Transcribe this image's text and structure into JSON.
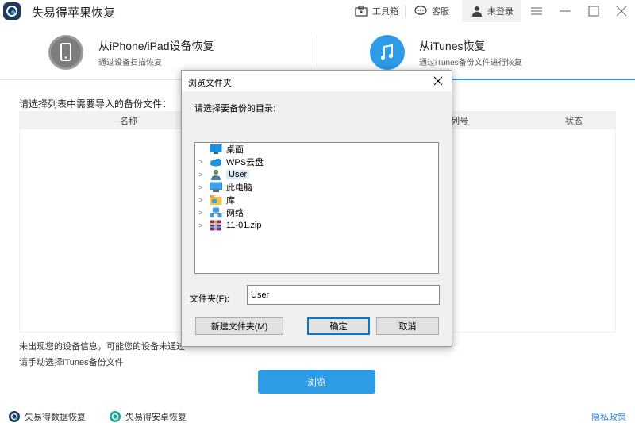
{
  "app": {
    "title": "失易得苹果恢复"
  },
  "titlebar": {
    "toolbox_label": "工具箱",
    "support_label": "客服",
    "login_label": "未登录"
  },
  "modes": [
    {
      "title": "从iPhone/iPad设备恢复",
      "subtitle": "通过设备扫描恢复"
    },
    {
      "title": "从iTunes恢复",
      "subtitle": "通过iTunes备份文件进行恢复"
    }
  ],
  "content": {
    "prompt": "请选择列表中需要导入的备份文件：",
    "columns": [
      "名称",
      "列号",
      "状态"
    ],
    "notice1": "未出现您的设备信息，可能您的设备未通过",
    "notice2": "请手动选择iTunes备份文件",
    "browse_label": "浏览"
  },
  "footer": {
    "link1": "失易得数据恢复",
    "link2": "失易得安卓恢复",
    "privacy": "隐私政策"
  },
  "dialog": {
    "title": "浏览文件夹",
    "prompt": "请选择要备份的目录:",
    "tree": [
      {
        "label": "桌面",
        "icon": "desktop-icon",
        "expandable": false,
        "selected": false
      },
      {
        "label": "WPS云盘",
        "icon": "cloud-icon",
        "expandable": true,
        "selected": false
      },
      {
        "label": "User",
        "icon": "user-icon",
        "expandable": true,
        "selected": true
      },
      {
        "label": "此电脑",
        "icon": "computer-icon",
        "expandable": true,
        "selected": false
      },
      {
        "label": "库",
        "icon": "library-icon",
        "expandable": true,
        "selected": false
      },
      {
        "label": "网络",
        "icon": "network-icon",
        "expandable": true,
        "selected": false
      },
      {
        "label": "11-01.zip",
        "icon": "zip-icon",
        "expandable": true,
        "selected": false
      }
    ],
    "folder_label": "文件夹(F):",
    "folder_value": "User",
    "new_folder_label": "新建文件夹(M)",
    "ok_label": "确定",
    "cancel_label": "取消"
  },
  "colors": {
    "accent": "#2e9be6",
    "brand_dark": "#1f3a5c",
    "selection": "#dbe9f7"
  }
}
